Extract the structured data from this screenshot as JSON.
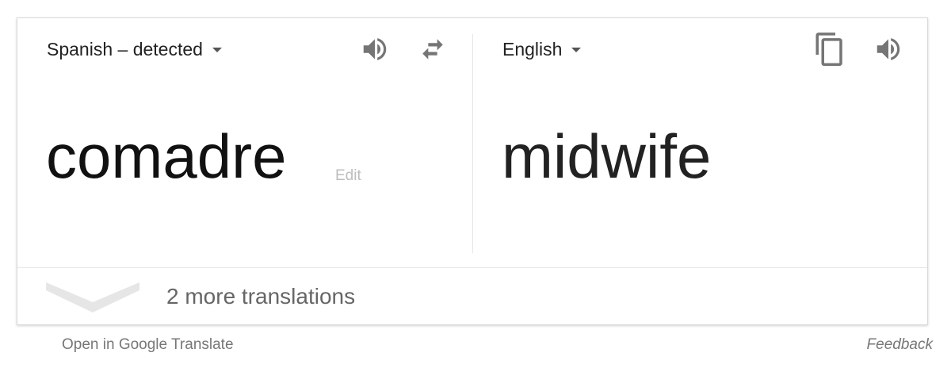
{
  "source": {
    "language_label": "Spanish – detected",
    "text": "comadre",
    "edit_label": "Edit"
  },
  "target": {
    "language_label": "English",
    "text": "midwife"
  },
  "icons": {
    "speaker": "speaker-icon",
    "swap": "swap-arrows-icon",
    "copy": "copy-icon",
    "chevron": "chevron-down-icon"
  },
  "more": {
    "label": "2 more translations"
  },
  "footer": {
    "open_label": "Open in Google Translate",
    "feedback_label": "Feedback"
  },
  "colors": {
    "icon_gray": "#757575",
    "chevron_gray": "#e6e6e6",
    "edit_gray": "#bdbdbd"
  }
}
